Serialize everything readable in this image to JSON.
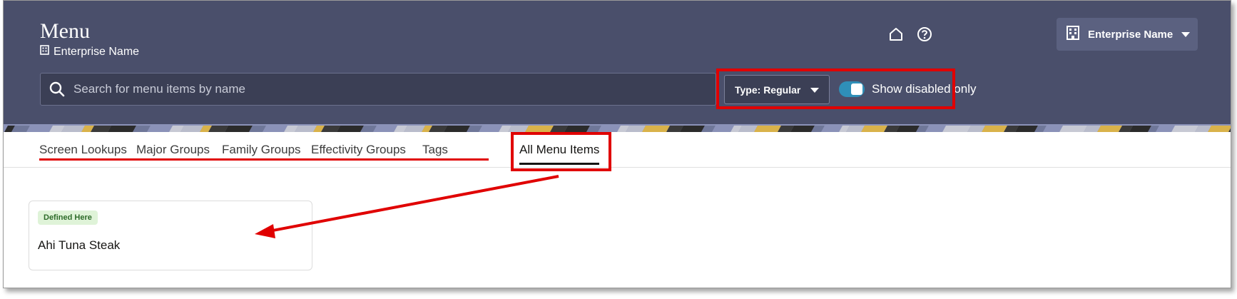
{
  "header": {
    "title": "Menu",
    "subtitle": "Enterprise Name",
    "enterprise_button": "Enterprise Name",
    "icons": [
      "building-icon",
      "home-icon",
      "help-icon",
      "chevron-down-icon"
    ]
  },
  "search": {
    "placeholder": "Search for menu items by name",
    "value": ""
  },
  "filters": {
    "type_label": "Type: Regular",
    "toggle_label": "Show disabled only",
    "toggle_on": true
  },
  "tabs": [
    {
      "label": "Screen Lookups"
    },
    {
      "label": "Major Groups"
    },
    {
      "label": "Family Groups"
    },
    {
      "label": "Effectivity Groups"
    },
    {
      "label": "Tags"
    },
    {
      "label": "All Menu Items",
      "active": true
    }
  ],
  "cards": [
    {
      "badge": "Defined Here",
      "name": "Ahi Tuna Steak"
    }
  ],
  "colors": {
    "header_bg": "#4a4f6b",
    "annotation_red": "#e00000",
    "toggle_on": "#2f8fb8",
    "badge_bg": "#dff3d8"
  }
}
